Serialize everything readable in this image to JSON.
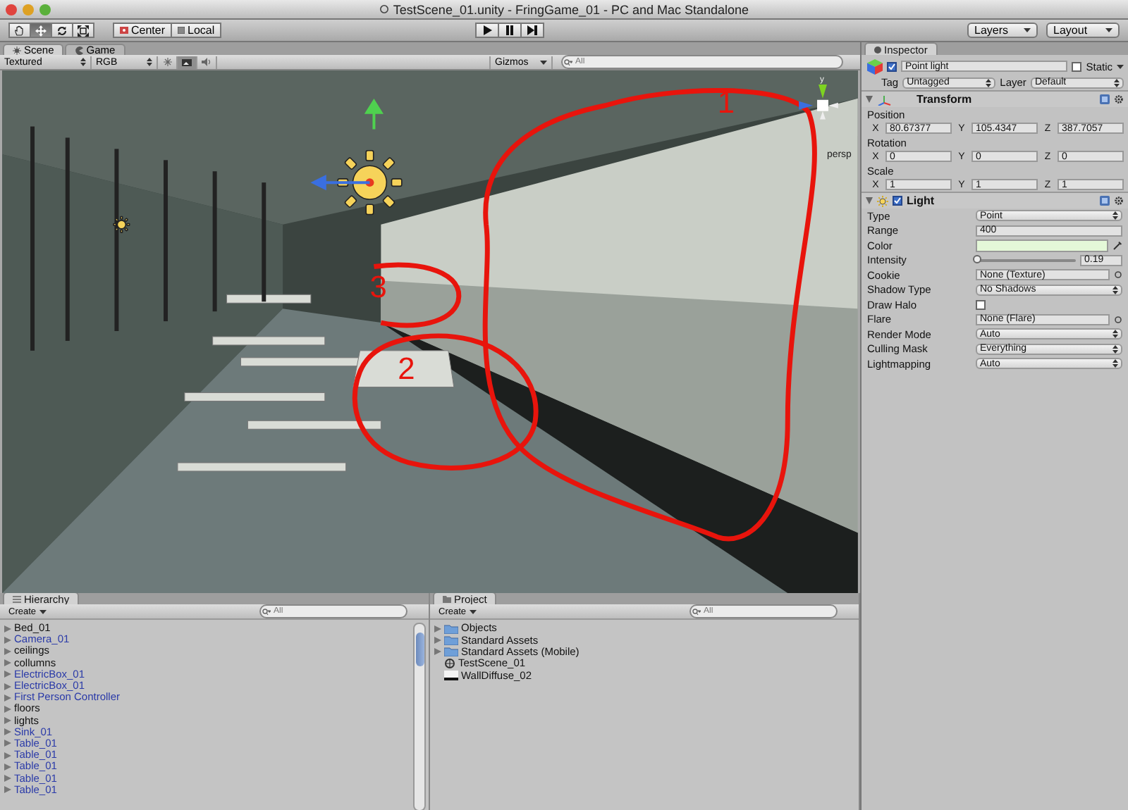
{
  "window": {
    "title": "TestScene_01.unity - FringGame_01 - PC and Mac Standalone"
  },
  "toolbar": {
    "tools": [
      {
        "kind": "hand",
        "selected": false
      },
      {
        "kind": "move",
        "selected": true
      },
      {
        "kind": "rotate",
        "selected": false
      },
      {
        "kind": "scale",
        "selected": false
      }
    ],
    "pivot_buttons": [
      {
        "kind": "center",
        "label": "Center"
      },
      {
        "kind": "local",
        "label": "Local"
      }
    ],
    "play_controls": [
      {
        "kind": "play"
      },
      {
        "kind": "pause"
      },
      {
        "kind": "step"
      }
    ],
    "layers": "Layers",
    "layout": "Layout"
  },
  "scene_panel": {
    "tabs": [
      {
        "label": "Scene",
        "kind": "scene",
        "selected": true
      },
      {
        "label": "Game",
        "kind": "game",
        "selected": false
      }
    ],
    "toggles": [
      {
        "kind": "lighting",
        "on": false
      },
      {
        "kind": "image",
        "on": true
      },
      {
        "kind": "audio",
        "on": false
      }
    ],
    "draw_mode": "Textured",
    "render_mode": "RGB",
    "gizmos": "Gizmos",
    "search_placeholder": "All",
    "view_label": "persp",
    "axis_label": "y",
    "annotations": [
      {
        "label": "1"
      },
      {
        "label": "2"
      },
      {
        "label": "3"
      }
    ]
  },
  "hierarchy": {
    "title": "Hierarchy",
    "create": "Create",
    "search_placeholder": "All",
    "items": [
      {
        "label": "Bed_01",
        "prefab": false
      },
      {
        "label": "Camera_01",
        "prefab": true
      },
      {
        "label": "ceilings",
        "prefab": false
      },
      {
        "label": "collumns",
        "prefab": false
      },
      {
        "label": "ElectricBox_01",
        "prefab": true
      },
      {
        "label": "ElectricBox_01",
        "prefab": true
      },
      {
        "label": "First Person Controller",
        "prefab": true
      },
      {
        "label": "floors",
        "prefab": false
      },
      {
        "label": "lights",
        "prefab": false
      },
      {
        "label": "Sink_01",
        "prefab": true
      },
      {
        "label": "Table_01",
        "prefab": true
      },
      {
        "label": "Table_01",
        "prefab": true
      },
      {
        "label": "Table_01",
        "prefab": true
      },
      {
        "label": "Table_01",
        "prefab": true
      },
      {
        "label": "Table_01",
        "prefab": true
      }
    ]
  },
  "project": {
    "title": "Project",
    "create": "Create",
    "search_placeholder": "All",
    "items": [
      {
        "label": "Objects",
        "kind": "folder"
      },
      {
        "label": "Standard Assets",
        "kind": "folder"
      },
      {
        "label": "Standard Assets (Mobile)",
        "kind": "folder"
      },
      {
        "label": "TestScene_01",
        "kind": "scene"
      },
      {
        "label": "WallDiffuse_02",
        "kind": "material"
      }
    ]
  },
  "inspector": {
    "title": "Inspector",
    "object": {
      "active": true,
      "name": "Point light",
      "static": false,
      "static_label": "Static",
      "tag_label": "Tag",
      "tag": "Untagged",
      "layer_label": "Layer",
      "layer": "Default"
    },
    "components": [
      {
        "kind": "transform",
        "name": "Transform",
        "fields": [
          {
            "label": "Position",
            "values": [
              {
                "axis": "X",
                "value": "80.67377"
              },
              {
                "axis": "Y",
                "value": "105.4347"
              },
              {
                "axis": "Z",
                "value": "387.7057"
              }
            ]
          },
          {
            "label": "Rotation",
            "values": [
              {
                "axis": "X",
                "value": "0"
              },
              {
                "axis": "Y",
                "value": "0"
              },
              {
                "axis": "Z",
                "value": "0"
              }
            ]
          },
          {
            "label": "Scale",
            "values": [
              {
                "axis": "X",
                "value": "1"
              },
              {
                "axis": "Y",
                "value": "1"
              },
              {
                "axis": "Z",
                "value": "1"
              }
            ]
          }
        ]
      },
      {
        "kind": "light",
        "name": "Light",
        "enabled": true,
        "properties": [
          {
            "kind": "dropdown",
            "label": "Type",
            "value": "Point"
          },
          {
            "kind": "text",
            "label": "Range",
            "value": "400"
          },
          {
            "kind": "color",
            "label": "Color",
            "color": "#e4f8d8"
          },
          {
            "kind": "slider",
            "label": "Intensity",
            "level": 0.02,
            "value": "0.19"
          },
          {
            "kind": "object",
            "label": "Cookie",
            "value": "None (Texture)"
          },
          {
            "kind": "dropdown",
            "label": "Shadow Type",
            "value": "No Shadows"
          },
          {
            "kind": "checkbox",
            "label": "Draw Halo",
            "checked": false
          },
          {
            "kind": "object",
            "label": "Flare",
            "value": "None (Flare)"
          },
          {
            "kind": "dropdown",
            "label": "Render Mode",
            "value": "Auto"
          },
          {
            "kind": "dropdown",
            "label": "Culling Mask",
            "value": "Everything"
          },
          {
            "kind": "dropdown",
            "label": "Lightmapping",
            "value": "Auto"
          }
        ]
      }
    ]
  }
}
